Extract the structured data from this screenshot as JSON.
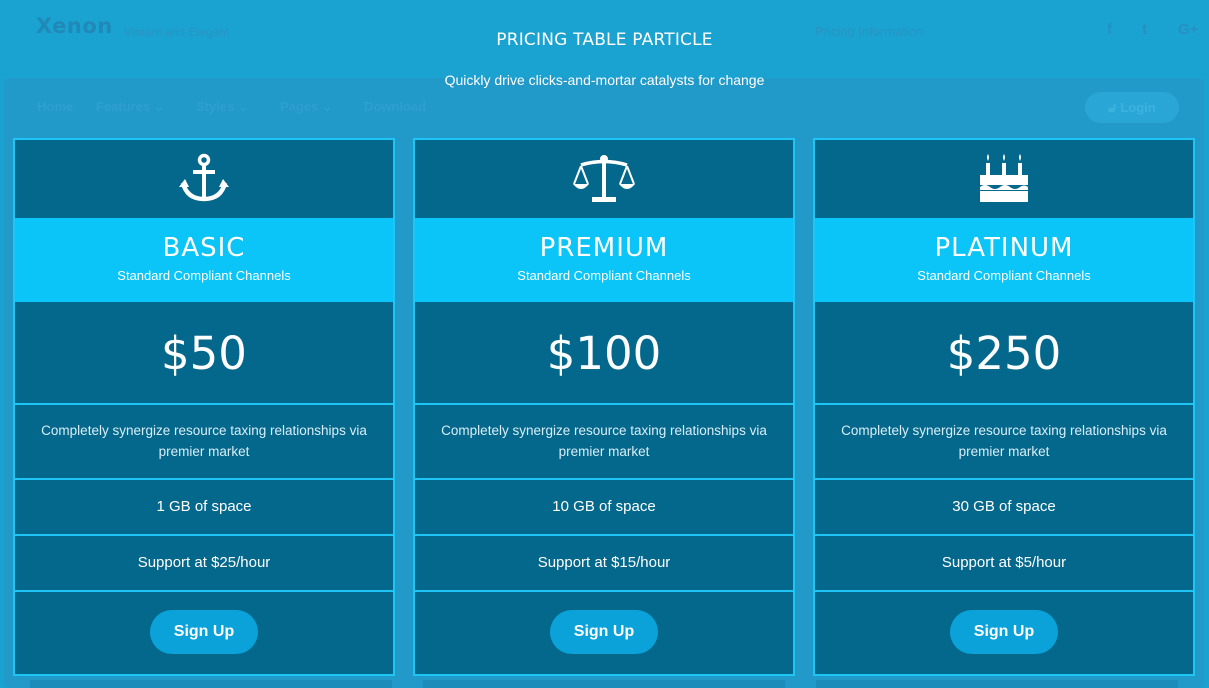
{
  "background": {
    "logo": "Xenon",
    "tagline": "Vibrant and Elegant",
    "info_link": "Pricing Information",
    "social": [
      "f",
      "t",
      "G+"
    ],
    "nav": [
      "Home",
      "Features ⌄",
      "Styles ⌄",
      "Pages ⌄",
      "Download"
    ],
    "login_label": "Login"
  },
  "section": {
    "title": "PRICING TABLE PARTICLE",
    "subtitle": "Quickly drive clicks-and-mortar catalysts for change"
  },
  "plans": [
    {
      "icon": "anchor-icon",
      "name": "BASIC",
      "tagline": "Standard Compliant Channels",
      "price": "$50",
      "description": "Completely synergize resource taxing relationships via premier market",
      "space": "1 GB of space",
      "support": "Support at $25/hour",
      "button": "Sign Up"
    },
    {
      "icon": "balance-scale-icon",
      "name": "PREMIUM",
      "tagline": "Standard Compliant Channels",
      "price": "$100",
      "description": "Completely synergize resource taxing relationships via premier market",
      "space": "10 GB of space",
      "support": "Support at $15/hour",
      "button": "Sign Up"
    },
    {
      "icon": "birthday-cake-icon",
      "name": "PLATINUM",
      "tagline": "Standard Compliant Channels",
      "price": "$250",
      "description": "Completely synergize resource taxing relationships via premier market",
      "space": "30 GB of space",
      "support": "Support at $5/hour",
      "button": "Sign Up"
    }
  ],
  "colors": {
    "overlay": "#1aa3d0",
    "card_body": "#04688c",
    "card_head": "#0bc4f8",
    "card_border": "#1ec5f5",
    "button": "#0aa2d8"
  }
}
